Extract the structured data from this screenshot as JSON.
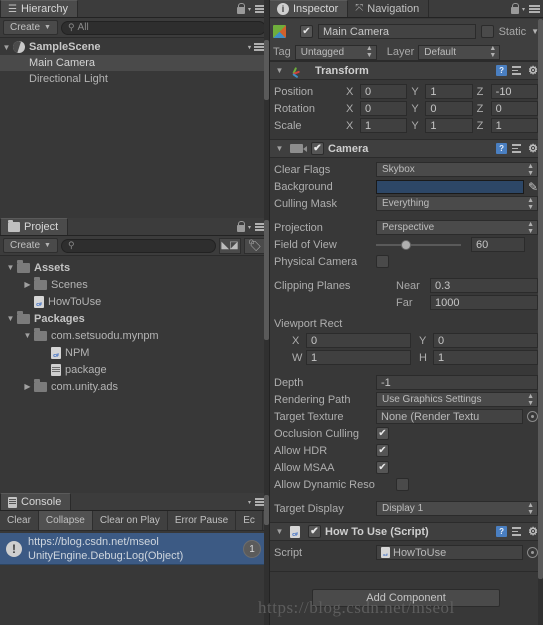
{
  "hierarchy": {
    "tab_label": "Hierarchy",
    "create_label": "Create",
    "search_placeholder": "All",
    "scene_name": "SampleScene",
    "items": [
      {
        "label": "Main Camera",
        "selected": true
      },
      {
        "label": "Directional Light",
        "selected": false
      }
    ]
  },
  "project": {
    "tab_label": "Project",
    "create_label": "Create",
    "search_placeholder": "",
    "rows": [
      {
        "label": "Assets",
        "indent": 0,
        "arrow": "down",
        "icon": "folder",
        "bold": true
      },
      {
        "label": "Scenes",
        "indent": 1,
        "arrow": "right",
        "icon": "folder",
        "bold": false
      },
      {
        "label": "HowToUse",
        "indent": 1,
        "arrow": "none",
        "icon": "csharp",
        "bold": false
      },
      {
        "label": "Packages",
        "indent": 0,
        "arrow": "down",
        "icon": "folder",
        "bold": true
      },
      {
        "label": "com.setsuodu.mynpm",
        "indent": 1,
        "arrow": "down",
        "icon": "folder",
        "bold": false
      },
      {
        "label": "NPM",
        "indent": 2,
        "arrow": "none",
        "icon": "csharp",
        "bold": false
      },
      {
        "label": "package",
        "indent": 2,
        "arrow": "none",
        "icon": "textfile",
        "bold": false
      },
      {
        "label": "com.unity.ads",
        "indent": 1,
        "arrow": "right",
        "icon": "folder",
        "bold": false
      }
    ]
  },
  "console": {
    "tab_label": "Console",
    "buttons": [
      {
        "label": "Clear",
        "active": false
      },
      {
        "label": "Collapse",
        "active": true
      },
      {
        "label": "Clear on Play",
        "active": false
      },
      {
        "label": "Error Pause",
        "active": false
      },
      {
        "label": "Ec",
        "active": false
      }
    ],
    "log": {
      "line1": "https://blog.csdn.net/mseol",
      "line2": "UnityEngine.Debug:Log(Object)",
      "count": "1"
    }
  },
  "inspector": {
    "tabs": [
      {
        "label": "Inspector",
        "active": true,
        "icon": "info-icon"
      },
      {
        "label": "Navigation",
        "active": false,
        "icon": "navigation-icon"
      }
    ],
    "object_name": "Main Camera",
    "object_enabled": true,
    "static_label": "Static",
    "static_checked": false,
    "tag_label": "Tag",
    "tag_value": "Untagged",
    "layer_label": "Layer",
    "layer_value": "Default",
    "transform": {
      "title": "Transform",
      "rows": [
        {
          "name": "Position",
          "x": "0",
          "y": "1",
          "z": "-10"
        },
        {
          "name": "Rotation",
          "x": "0",
          "y": "0",
          "z": "0"
        },
        {
          "name": "Scale",
          "x": "1",
          "y": "1",
          "z": "1"
        }
      ]
    },
    "camera": {
      "title": "Camera",
      "enabled": true,
      "clear_flags_label": "Clear Flags",
      "clear_flags_value": "Skybox",
      "background_label": "Background",
      "background_color": "#2d4767",
      "culling_mask_label": "Culling Mask",
      "culling_mask_value": "Everything",
      "projection_label": "Projection",
      "projection_value": "Perspective",
      "fov_label": "Field of View",
      "fov_value": "60",
      "physical_camera_label": "Physical Camera",
      "physical_camera_checked": false,
      "clipping_label": "Clipping Planes",
      "near_label": "Near",
      "near_value": "0.3",
      "far_label": "Far",
      "far_value": "1000",
      "viewport_label": "Viewport Rect",
      "viewport_x_label": "X",
      "viewport_x": "0",
      "viewport_y_label": "Y",
      "viewport_y": "0",
      "viewport_w_label": "W",
      "viewport_w": "1",
      "viewport_h_label": "H",
      "viewport_h": "1",
      "depth_label": "Depth",
      "depth_value": "-1",
      "rendering_path_label": "Rendering Path",
      "rendering_path_value": "Use Graphics Settings",
      "target_texture_label": "Target Texture",
      "target_texture_value": "None (Render Textu",
      "occlusion_label": "Occlusion Culling",
      "occlusion_checked": true,
      "hdr_label": "Allow HDR",
      "hdr_checked": true,
      "msaa_label": "Allow MSAA",
      "msaa_checked": true,
      "dynamic_label": "Allow Dynamic Reso",
      "dynamic_checked": false,
      "target_display_label": "Target Display",
      "target_display_value": "Display 1"
    },
    "script_component": {
      "title": "How To Use (Script)",
      "enabled": true,
      "script_label": "Script",
      "script_value": "HowToUse"
    },
    "add_component_label": "Add Component"
  },
  "watermark": "https://blog.csdn.net/mseol"
}
